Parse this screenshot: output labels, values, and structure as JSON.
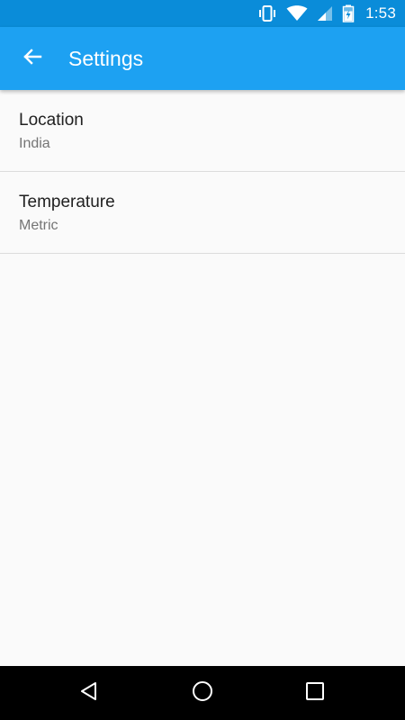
{
  "status_bar": {
    "time": "1:53",
    "icons": [
      "vibrate-icon",
      "wifi-icon",
      "signal-icon",
      "battery-charging-icon"
    ]
  },
  "app_bar": {
    "back_icon": "arrow-back-icon",
    "title": "Settings",
    "color": "#1da1f2"
  },
  "settings": {
    "items": [
      {
        "title": "Location",
        "summary": "India"
      },
      {
        "title": "Temperature",
        "summary": "Metric"
      }
    ]
  },
  "nav_bar": {
    "icons": [
      "back-triangle-icon",
      "home-circle-icon",
      "recents-square-icon"
    ]
  }
}
